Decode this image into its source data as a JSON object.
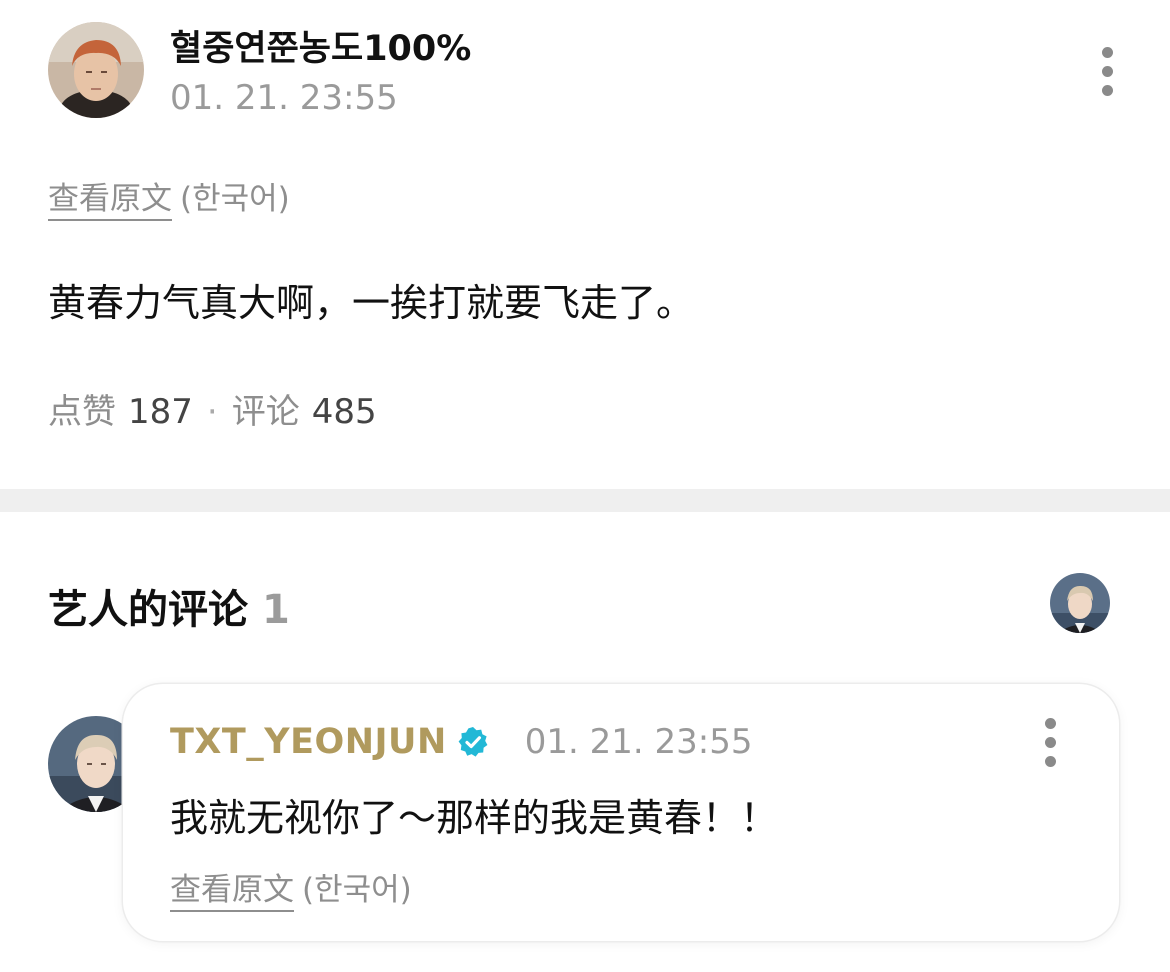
{
  "post": {
    "author_name": "혈중연쭌농도100%",
    "time": "01. 21. 23:55",
    "translate_link": "查看原文",
    "translate_lang": "(한국어)",
    "body": "黄春力气真大啊，一挨打就要飞走了。",
    "likes_label": "点赞",
    "likes_count": "187",
    "separator": "·",
    "comments_label": "评论",
    "comments_count": "485"
  },
  "artist_comments": {
    "title": "艺人的评论",
    "count": "1",
    "comment": {
      "author": "TXT_YEONJUN",
      "time": "01. 21. 23:55",
      "text": "我就无视你了～那样的我是黄春！！",
      "translate_link": "查看原文",
      "translate_lang": "(한국어)"
    }
  },
  "icons": {
    "more": "more-vertical-icon",
    "verified": "verified-badge-icon"
  },
  "colors": {
    "artist_name": "#b09a5e",
    "verified": "#22b8d6",
    "muted_text": "#9a9a9a",
    "divider": "#efefef"
  }
}
